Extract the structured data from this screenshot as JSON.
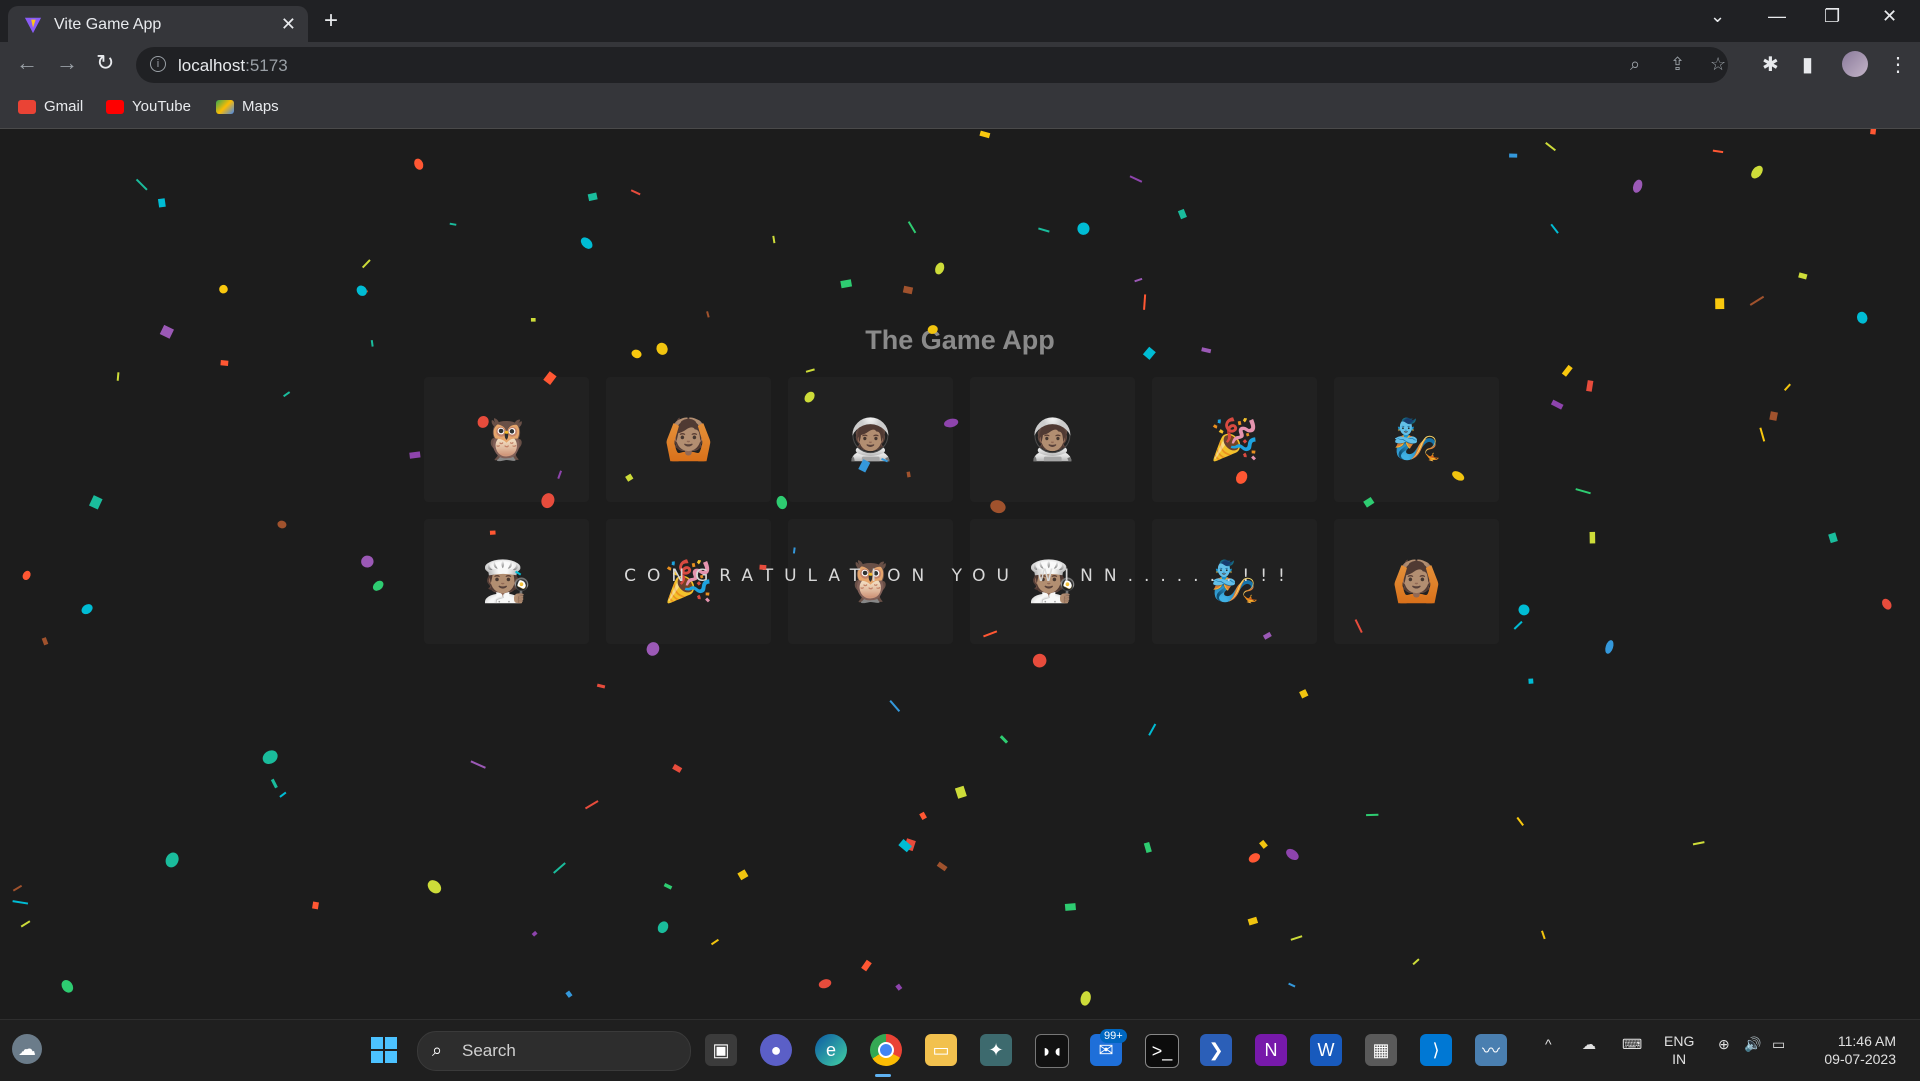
{
  "browser": {
    "tab_title": "Vite Game App",
    "new_tab": "+",
    "url_host": "localhost",
    "url_port": ":5173",
    "bookmarks": [
      {
        "label": "Gmail",
        "icon": "gmail-icon",
        "color": "#ea4335"
      },
      {
        "label": "YouTube",
        "icon": "youtube-icon",
        "color": "#ff0000"
      },
      {
        "label": "Maps",
        "icon": "maps-icon",
        "color": "#34a853"
      }
    ]
  },
  "page": {
    "title": "The Game App",
    "congrats": "CONGRATULATION YOU WINN.......!!!",
    "cards": [
      {
        "emoji": "🦉",
        "name": "owl"
      },
      {
        "emoji": "🙆🏽",
        "name": "person-gesturing-ok"
      },
      {
        "emoji": "🧑🏽‍🚀",
        "name": "astronaut"
      },
      {
        "emoji": "🧑🏽‍🚀",
        "name": "astronaut"
      },
      {
        "emoji": "🎉",
        "name": "party-popper"
      },
      {
        "emoji": "🧞",
        "name": "genie"
      },
      {
        "emoji": "🧑🏽‍🍳",
        "name": "cook"
      },
      {
        "emoji": "🎉",
        "name": "party-popper"
      },
      {
        "emoji": "🦉",
        "name": "owl"
      },
      {
        "emoji": "🧑🏽‍🍳",
        "name": "cook"
      },
      {
        "emoji": "🧞",
        "name": "genie"
      },
      {
        "emoji": "🙆🏽",
        "name": "person-gesturing-ok"
      }
    ]
  },
  "taskbar": {
    "search_placeholder": "Search",
    "mail_badge": "99+",
    "lang_line1": "ENG",
    "lang_line2": "IN",
    "time": "11:46 AM",
    "date": "09-07-2023"
  },
  "colors": {
    "confetti": [
      "#f9c80e",
      "#ff5733",
      "#2ecc71",
      "#3498db",
      "#9b59b6",
      "#1abc9c",
      "#e74c3c",
      "#f1c40f",
      "#8e44ad",
      "#00bcd4",
      "#a0522d",
      "#cddc39"
    ]
  }
}
